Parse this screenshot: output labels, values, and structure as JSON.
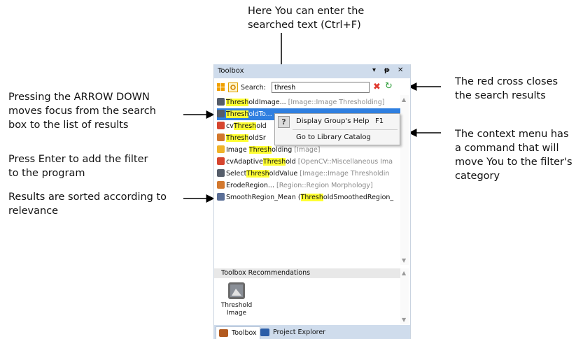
{
  "annotations": {
    "search_hint": "Here You can enter the\nsearched text (Ctrl+F)",
    "arrow_down_hint": "Pressing the ARROW DOWN\nmoves focus from the search\nbox to the list of results",
    "enter_hint": "Press Enter to add the filter\nto the program",
    "sorted_hint": "Results are sorted according to\nrelevance",
    "red_cross_hint": "The red cross closes\nthe search results",
    "context_menu_hint": "The context menu has\na command that will\nmove You to the filter's\ncategory"
  },
  "toolbox": {
    "title": "Toolbox",
    "controls": {
      "dropdown": "▾",
      "pin": "📌",
      "close": "✕"
    },
    "search_label": "Search:",
    "search_value": "thresh",
    "clear_icon_color": "#e03a2f",
    "results": [
      {
        "pre": "",
        "hl": "Thresh",
        "post": "oldImage...",
        "cat": "[Image::Image Thresholding]",
        "icon": "image-filter-icon",
        "color": "#555d6a"
      },
      {
        "pre": "",
        "hl": "Thresh",
        "post": "oldTo...",
        "cat": "",
        "icon": "image-filter-icon",
        "color": "#555d6a",
        "selected": true
      },
      {
        "pre": "cv",
        "hl": "Thresh",
        "post": "old",
        "cat": "",
        "icon": "opencv-icon",
        "color": "#d6452f"
      },
      {
        "pre": "",
        "hl": "Thresh",
        "post": "oldSr",
        "cat": "",
        "icon": "region-icon",
        "color": "#d2782e"
      },
      {
        "pre": "Image ",
        "hl": "Thresh",
        "post": "olding",
        "cat": "[Image]",
        "icon": "folder-icon",
        "color": "#f0b32a"
      },
      {
        "pre": "cvAdaptive",
        "hl": "Thresh",
        "post": "old",
        "cat": "[OpenCV::Miscellaneous Ima",
        "icon": "opencv-icon",
        "color": "#d6452f"
      },
      {
        "pre": "Select",
        "hl": "Thresh",
        "post": "oldValue",
        "cat": "[Image::Image Thresholdin",
        "icon": "image-filter-icon",
        "color": "#555d6a"
      },
      {
        "pre": "ErodeRegion...",
        "hl": "",
        "post": "",
        "cat": "[Region::Region Morphology]",
        "icon": "region-icon",
        "color": "#d2782e"
      },
      {
        "pre": "SmoothRegion_Mean (",
        "hl": "Thresh",
        "post": "oldSmoothedRegion_",
        "cat": "",
        "icon": "smooth-icon",
        "color": "#5a6e96"
      }
    ],
    "context_menu": {
      "items": [
        {
          "label": "Display Group's Help",
          "shortcut": "F1",
          "icon": "?"
        },
        {
          "label": "Go to Library Catalog",
          "shortcut": ""
        }
      ]
    },
    "recommendations": {
      "header": "Toolbox Recommendations",
      "items": [
        {
          "label": "Threshold\nImage",
          "icon": "image-filter-icon"
        }
      ]
    },
    "tabs": [
      {
        "label": "Toolbox",
        "icon": "toolbox-icon",
        "color": "#b25a1f",
        "active": true
      },
      {
        "label": "Project Explorer",
        "icon": "project-explorer-icon",
        "color": "#2c5ea8",
        "active": false
      }
    ]
  }
}
